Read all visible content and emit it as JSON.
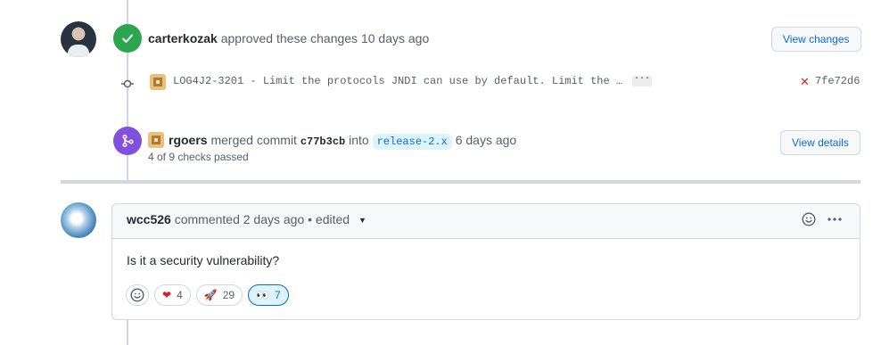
{
  "colors": {
    "approve_green": "#2da44e",
    "merge_purple": "#8250df",
    "link_blue": "#0969da",
    "fail_red": "#cf222e"
  },
  "review": {
    "author": "carterkozak",
    "action": "approved these changes",
    "time": "10 days ago",
    "button_label": "View changes",
    "avatar_icon": "user-avatar-icon",
    "status_icon": "check-icon"
  },
  "commit": {
    "message": "LOG4J2-3201 - Limit the protocols JNDI can use by default. Limit the …",
    "expand_label": "···",
    "status_icon": "x-icon",
    "status_glyph": "✕",
    "sha": "7fe72d6"
  },
  "merge": {
    "author": "rgoers",
    "action": "merged commit",
    "sha": "c77b3cb",
    "into_text": "into",
    "branch": "release-2.x",
    "time": "6 days ago",
    "checks": "4 of 9 checks passed",
    "button_label": "View details",
    "status_icon": "git-merge-icon"
  },
  "comment": {
    "author": "wcc526",
    "meta": "commented 2 days ago • edited",
    "body": "Is it a security vulnerability?",
    "reactions": [
      {
        "icon": "heart-icon",
        "emoji": "❤",
        "count": "4"
      },
      {
        "icon": "rocket-icon",
        "emoji": "🚀",
        "count": "29"
      },
      {
        "icon": "eyes-icon",
        "emoji": "👀",
        "count": "7"
      }
    ]
  }
}
